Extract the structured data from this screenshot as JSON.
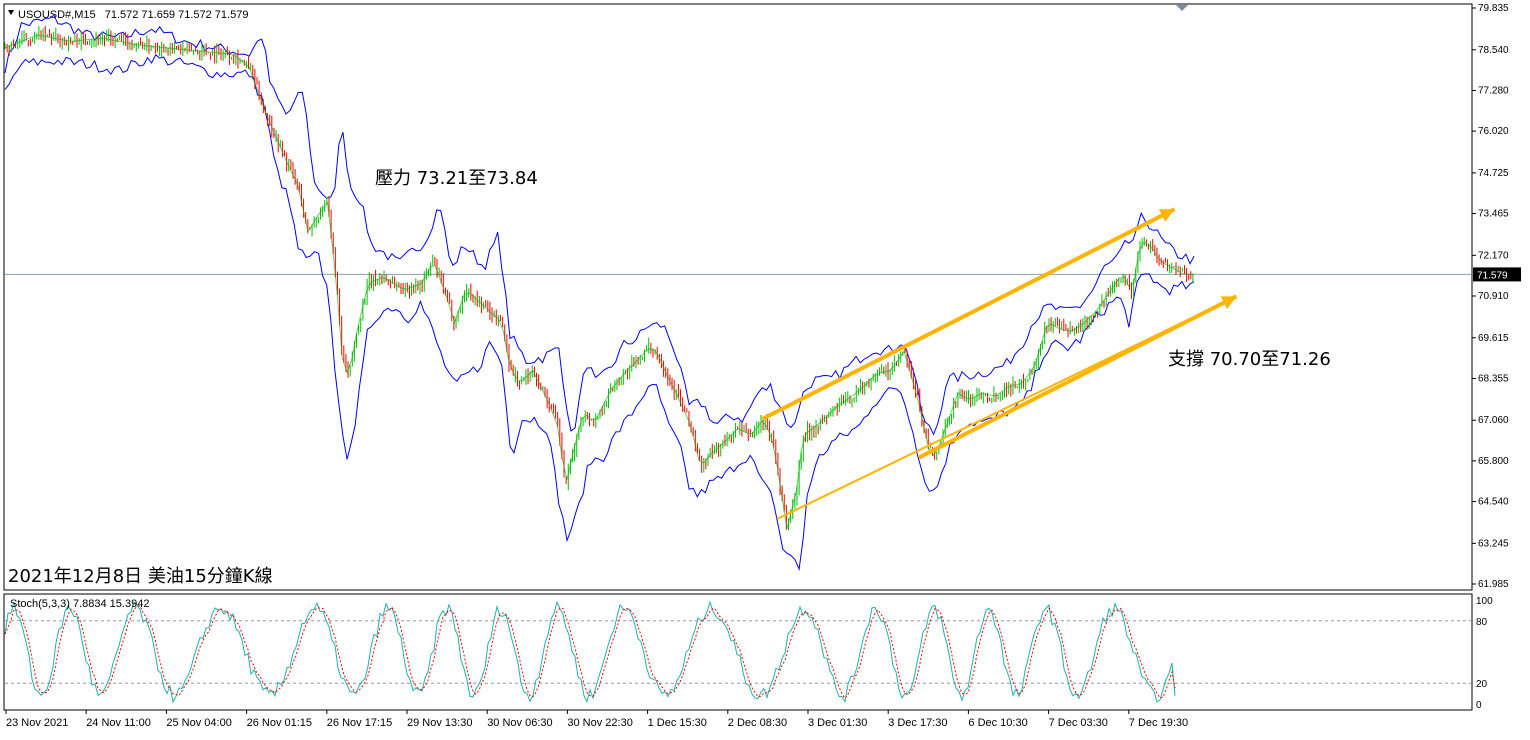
{
  "header": {
    "symbol": "USOUSD#,M15",
    "ohlc": "71.572 71.659 71.572 71.579"
  },
  "annotations": {
    "resistance": "壓力 73.21至73.84",
    "support": "支撐 70.70至71.26",
    "date_note": "2021年12月8日 美油15分鐘K線"
  },
  "colors": {
    "band": "#0000ff",
    "bull_candle": "#00c000",
    "bear_candle": "#ff0000",
    "trend_arrow": "#ffb400",
    "price_line": "#8aa0b4",
    "stoch_main": "#20b2aa",
    "stoch_signal": "#ff0000"
  },
  "chart_data": [
    {
      "type": "candlestick",
      "symbol": "USOUSD#",
      "timeframe": "M15",
      "current_price": "71.579",
      "y_ticks": [
        "79.835",
        "78.540",
        "77.280",
        "76.020",
        "74.725",
        "73.465",
        "72.170",
        "70.910",
        "69.615",
        "68.355",
        "67.060",
        "65.800",
        "64.540",
        "63.245",
        "61.985"
      ],
      "ylim": [
        61.985,
        79.835
      ],
      "x_ticks": [
        "23 Nov 2021",
        "24 Nov 11:00",
        "25 Nov 04:00",
        "26 Nov 01:15",
        "26 Nov 17:15",
        "29 Nov 13:30",
        "30 Nov 06:30",
        "30 Nov 22:30",
        "1 Dec 15:30",
        "2 Dec 08:30",
        "3 Dec 01:30",
        "3 Dec 17:30",
        "6 Dec 10:30",
        "7 Dec 03:30",
        "7 Dec 19:30"
      ],
      "price_path": [
        [
          0,
          78.6
        ],
        [
          2,
          79.0
        ],
        [
          4,
          78.8
        ],
        [
          6,
          78.9
        ],
        [
          8,
          78.7
        ],
        [
          10,
          78.6
        ],
        [
          12,
          78.5
        ],
        [
          14,
          78.4
        ],
        [
          15,
          78.0
        ],
        [
          16,
          76.6
        ],
        [
          17,
          75.4
        ],
        [
          18,
          74.3
        ],
        [
          18.6,
          72.9
        ],
        [
          19.2,
          73.4
        ],
        [
          19.8,
          73.8
        ],
        [
          20.3,
          71.6
        ],
        [
          20.7,
          69.0
        ],
        [
          21.1,
          68.4
        ],
        [
          21.6,
          69.8
        ],
        [
          22.3,
          71.3
        ],
        [
          23.2,
          71.5
        ],
        [
          24.5,
          71.1
        ],
        [
          25.6,
          71.3
        ],
        [
          26.3,
          72.0
        ],
        [
          27.1,
          70.9
        ],
        [
          27.6,
          70.1
        ],
        [
          28.3,
          71.1
        ],
        [
          29.4,
          70.6
        ],
        [
          30.5,
          70.1
        ],
        [
          31,
          68.7
        ],
        [
          31.6,
          68.2
        ],
        [
          32.4,
          68.6
        ],
        [
          33.2,
          67.8
        ],
        [
          34,
          66.8
        ],
        [
          34.4,
          65.0
        ],
        [
          34.9,
          66.1
        ],
        [
          35.5,
          67.3
        ],
        [
          36.2,
          67.0
        ],
        [
          37.2,
          68.0
        ],
        [
          38,
          68.5
        ],
        [
          38.8,
          68.9
        ],
        [
          39.5,
          69.3
        ],
        [
          40,
          69.2
        ],
        [
          40.6,
          68.5
        ],
        [
          41.3,
          67.8
        ],
        [
          42.1,
          66.9
        ],
        [
          42.7,
          65.6
        ],
        [
          43.3,
          66.0
        ],
        [
          44.2,
          66.4
        ],
        [
          45,
          66.8
        ],
        [
          45.8,
          66.6
        ],
        [
          46.6,
          67.1
        ],
        [
          47.2,
          66.3
        ],
        [
          47.6,
          65.0
        ],
        [
          48.0,
          63.7
        ],
        [
          48.6,
          64.9
        ],
        [
          49.0,
          66.6
        ],
        [
          49.6,
          66.8
        ],
        [
          50.3,
          67.1
        ],
        [
          51.1,
          67.5
        ],
        [
          52,
          67.8
        ],
        [
          52.7,
          68.1
        ],
        [
          53.5,
          68.5
        ],
        [
          54.4,
          68.6
        ],
        [
          55.2,
          69.2
        ],
        [
          56,
          67.8
        ],
        [
          56.7,
          66.2
        ],
        [
          57.1,
          65.9
        ],
        [
          57.8,
          66.9
        ],
        [
          58.5,
          67.9
        ],
        [
          59.2,
          67.7
        ],
        [
          60,
          67.9
        ],
        [
          60.8,
          67.8
        ],
        [
          61.6,
          68.1
        ],
        [
          62.4,
          68.2
        ],
        [
          63.2,
          68.7
        ],
        [
          64,
          70.1
        ],
        [
          64.7,
          69.9
        ],
        [
          65.5,
          69.8
        ],
        [
          66.3,
          70.1
        ],
        [
          67.1,
          70.5
        ],
        [
          67.9,
          71.1
        ],
        [
          68.6,
          71.6
        ],
        [
          69.2,
          71.0
        ],
        [
          69.7,
          72.6
        ],
        [
          70.3,
          72.5
        ],
        [
          70.9,
          72.0
        ],
        [
          71.6,
          71.8
        ],
        [
          72.3,
          71.6
        ],
        [
          73,
          71.58
        ]
      ],
      "bands": {
        "upper": [
          [
            0,
            78.0
          ],
          [
            1,
            79.3
          ],
          [
            3,
            79.5
          ],
          [
            5,
            79.0
          ],
          [
            7,
            78.9
          ],
          [
            9,
            79.2
          ],
          [
            11,
            78.8
          ],
          [
            13,
            78.6
          ],
          [
            15,
            78.4
          ],
          [
            15.8,
            79.0
          ],
          [
            16.3,
            77.4
          ],
          [
            17.3,
            76.5
          ],
          [
            18.3,
            77.3
          ],
          [
            19,
            74.4
          ],
          [
            19.7,
            74.0
          ],
          [
            20.2,
            73.8
          ],
          [
            20.6,
            76.4
          ],
          [
            21.2,
            74.3
          ],
          [
            21.8,
            73.9
          ],
          [
            22.5,
            72.5
          ],
          [
            23.4,
            72.2
          ],
          [
            24.2,
            71.9
          ],
          [
            25,
            72.3
          ],
          [
            25.8,
            72.6
          ],
          [
            26.7,
            73.8
          ],
          [
            27.4,
            71.7
          ],
          [
            28.2,
            72.5
          ],
          [
            29.4,
            71.8
          ],
          [
            30.3,
            72.8
          ],
          [
            31,
            69.7
          ],
          [
            32,
            68.9
          ],
          [
            33,
            69.0
          ],
          [
            34,
            69.3
          ],
          [
            34.8,
            66.4
          ],
          [
            35.7,
            68.9
          ],
          [
            36.3,
            68.2
          ],
          [
            37.2,
            68.7
          ],
          [
            38,
            69.4
          ],
          [
            38.8,
            69.6
          ],
          [
            39.5,
            70.0
          ],
          [
            40.4,
            70.0
          ],
          [
            41.1,
            69.3
          ],
          [
            42,
            67.5
          ],
          [
            42.8,
            67.6
          ],
          [
            43.6,
            66.9
          ],
          [
            44.6,
            67.2
          ],
          [
            45.4,
            67.1
          ],
          [
            46.2,
            67.9
          ],
          [
            47,
            68.1
          ],
          [
            47.6,
            67.5
          ],
          [
            48.3,
            66.7
          ],
          [
            48.9,
            67.8
          ],
          [
            49.6,
            68.3
          ],
          [
            50.6,
            68.3
          ],
          [
            51.5,
            68.6
          ],
          [
            52.5,
            69.0
          ],
          [
            53.4,
            69.3
          ],
          [
            54.2,
            69.2
          ],
          [
            55,
            69.5
          ],
          [
            55.6,
            69.0
          ],
          [
            56.4,
            67.0
          ],
          [
            57.1,
            66.6
          ],
          [
            57.8,
            68.3
          ],
          [
            58.6,
            68.4
          ],
          [
            59.6,
            68.5
          ],
          [
            60.6,
            68.6
          ],
          [
            61.5,
            68.8
          ],
          [
            62.4,
            69.4
          ],
          [
            63.2,
            70.2
          ],
          [
            64.1,
            70.6
          ],
          [
            65,
            70.4
          ],
          [
            66,
            70.6
          ],
          [
            66.8,
            71.1
          ],
          [
            67.5,
            71.8
          ],
          [
            68.2,
            72.0
          ],
          [
            68.8,
            72.5
          ],
          [
            69.4,
            72.7
          ],
          [
            69.8,
            73.4
          ],
          [
            70.5,
            73.0
          ],
          [
            71.2,
            72.5
          ],
          [
            72,
            72.2
          ],
          [
            73,
            72.0
          ]
        ],
        "lower": [
          [
            0,
            77.2
          ],
          [
            1,
            78.1
          ],
          [
            3,
            78.2
          ],
          [
            5,
            78.1
          ],
          [
            7,
            77.9
          ],
          [
            9,
            78.3
          ],
          [
            11,
            78.1
          ],
          [
            13,
            77.8
          ],
          [
            15,
            77.8
          ],
          [
            15.9,
            76.9
          ],
          [
            16.6,
            74.9
          ],
          [
            17.4,
            73.9
          ],
          [
            18.0,
            72.4
          ],
          [
            18.5,
            72.0
          ],
          [
            19.2,
            72.2
          ],
          [
            19.9,
            70.9
          ],
          [
            20.4,
            67.8
          ],
          [
            20.9,
            65.8
          ],
          [
            21.5,
            67.0
          ],
          [
            22.3,
            69.9
          ],
          [
            23.0,
            70.4
          ],
          [
            23.9,
            70.6
          ],
          [
            24.7,
            70.2
          ],
          [
            25.5,
            70.7
          ],
          [
            26.2,
            69.9
          ],
          [
            26.9,
            68.9
          ],
          [
            27.6,
            68.1
          ],
          [
            28.4,
            68.5
          ],
          [
            29.1,
            68.7
          ],
          [
            29.8,
            69.5
          ],
          [
            30.5,
            68.8
          ],
          [
            31.1,
            65.9
          ],
          [
            31.7,
            67.1
          ],
          [
            32.5,
            67.1
          ],
          [
            33.3,
            66.8
          ],
          [
            34.1,
            64.3
          ],
          [
            34.5,
            63.4
          ],
          [
            35.1,
            64.1
          ],
          [
            35.9,
            65.8
          ],
          [
            36.7,
            65.9
          ],
          [
            37.6,
            66.7
          ],
          [
            38.4,
            67.2
          ],
          [
            39.2,
            67.9
          ],
          [
            40.0,
            68.1
          ],
          [
            40.7,
            66.9
          ],
          [
            41.4,
            66.3
          ],
          [
            42.0,
            65.0
          ],
          [
            42.6,
            64.7
          ],
          [
            43.3,
            65.1
          ],
          [
            44.1,
            65.3
          ],
          [
            44.9,
            65.7
          ],
          [
            45.7,
            66.0
          ],
          [
            46.5,
            65.1
          ],
          [
            47.2,
            64.6
          ],
          [
            47.7,
            63.1
          ],
          [
            48.2,
            62.9
          ],
          [
            48.8,
            62.4
          ],
          [
            49.3,
            65.0
          ],
          [
            50.0,
            65.9
          ],
          [
            50.8,
            66.4
          ],
          [
            51.6,
            66.6
          ],
          [
            52.5,
            66.9
          ],
          [
            53.3,
            67.6
          ],
          [
            54.1,
            67.9
          ],
          [
            54.9,
            68.1
          ],
          [
            55.7,
            66.9
          ],
          [
            56.4,
            65.2
          ],
          [
            57.1,
            64.8
          ],
          [
            57.9,
            66.1
          ],
          [
            58.7,
            66.9
          ],
          [
            59.5,
            67.0
          ],
          [
            60.4,
            67.0
          ],
          [
            61.3,
            67.3
          ],
          [
            62.1,
            67.4
          ],
          [
            62.9,
            67.9
          ],
          [
            63.7,
            69.1
          ],
          [
            64.5,
            69.4
          ],
          [
            65.3,
            69.3
          ],
          [
            66.1,
            69.6
          ],
          [
            66.9,
            70.2
          ],
          [
            67.7,
            70.6
          ],
          [
            68.4,
            70.9
          ],
          [
            69.0,
            70.1
          ],
          [
            69.6,
            71.4
          ],
          [
            70.2,
            71.6
          ],
          [
            70.9,
            71.2
          ],
          [
            71.6,
            71.1
          ],
          [
            72.3,
            71.2
          ],
          [
            73,
            71.2
          ]
        ]
      },
      "channel_lines": {
        "resistance": {
          "from": [
            46.5,
            67.1
          ],
          "to": [
            71.8,
            73.6
          ]
        },
        "support": {
          "from": [
            47.4,
            64.0
          ],
          "to": [
            75.6,
            70.9
          ]
        },
        "arrow_upper": {
          "from": [
            46.5,
            67.1
          ],
          "to": [
            71.8,
            73.6
          ]
        },
        "arrow_lower": {
          "from": [
            56.1,
            65.9
          ],
          "to": [
            75.6,
            70.9
          ]
        }
      },
      "x_domain": [
        0,
        90
      ]
    },
    {
      "type": "line",
      "indicator": "Stoch(5,3,3)",
      "label": "Stoch(5,3,3) 7.8834 15.3942",
      "main": "7.8834",
      "signal": "15.3942",
      "y_ticks": [
        "100",
        "80",
        "20",
        "0"
      ],
      "ylim": [
        0,
        100
      ],
      "levels": [
        20,
        80
      ]
    }
  ]
}
